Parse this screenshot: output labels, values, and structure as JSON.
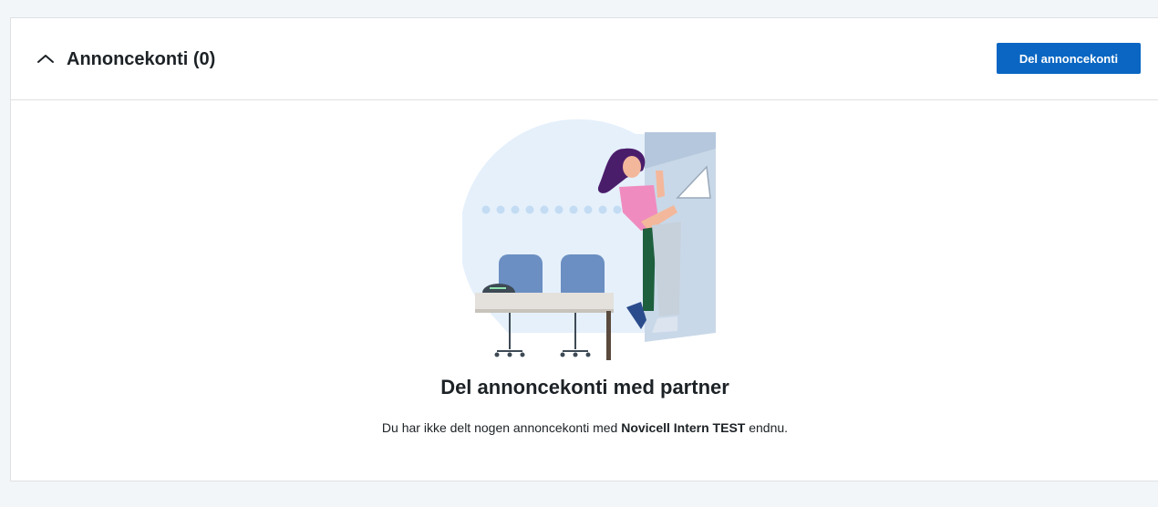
{
  "section": {
    "title": "Annoncekonti (0)",
    "share_button_label": "Del annoncekonti",
    "toggle_icon": "chevron-up-icon"
  },
  "empty_state": {
    "heading": "Del annoncekonti med partner",
    "description_prefix": "Du har ikke delt nogen annoncekonti med ",
    "partner_name": "Novicell Intern TEST",
    "description_suffix": " endnu.",
    "illustration": "woman-leaning-on-door-with-laptop-illustration"
  },
  "colors": {
    "accent": "#0a66c2",
    "page_background": "#f3f6f8",
    "card_background": "#ffffff",
    "border": "#dfe1e3"
  }
}
